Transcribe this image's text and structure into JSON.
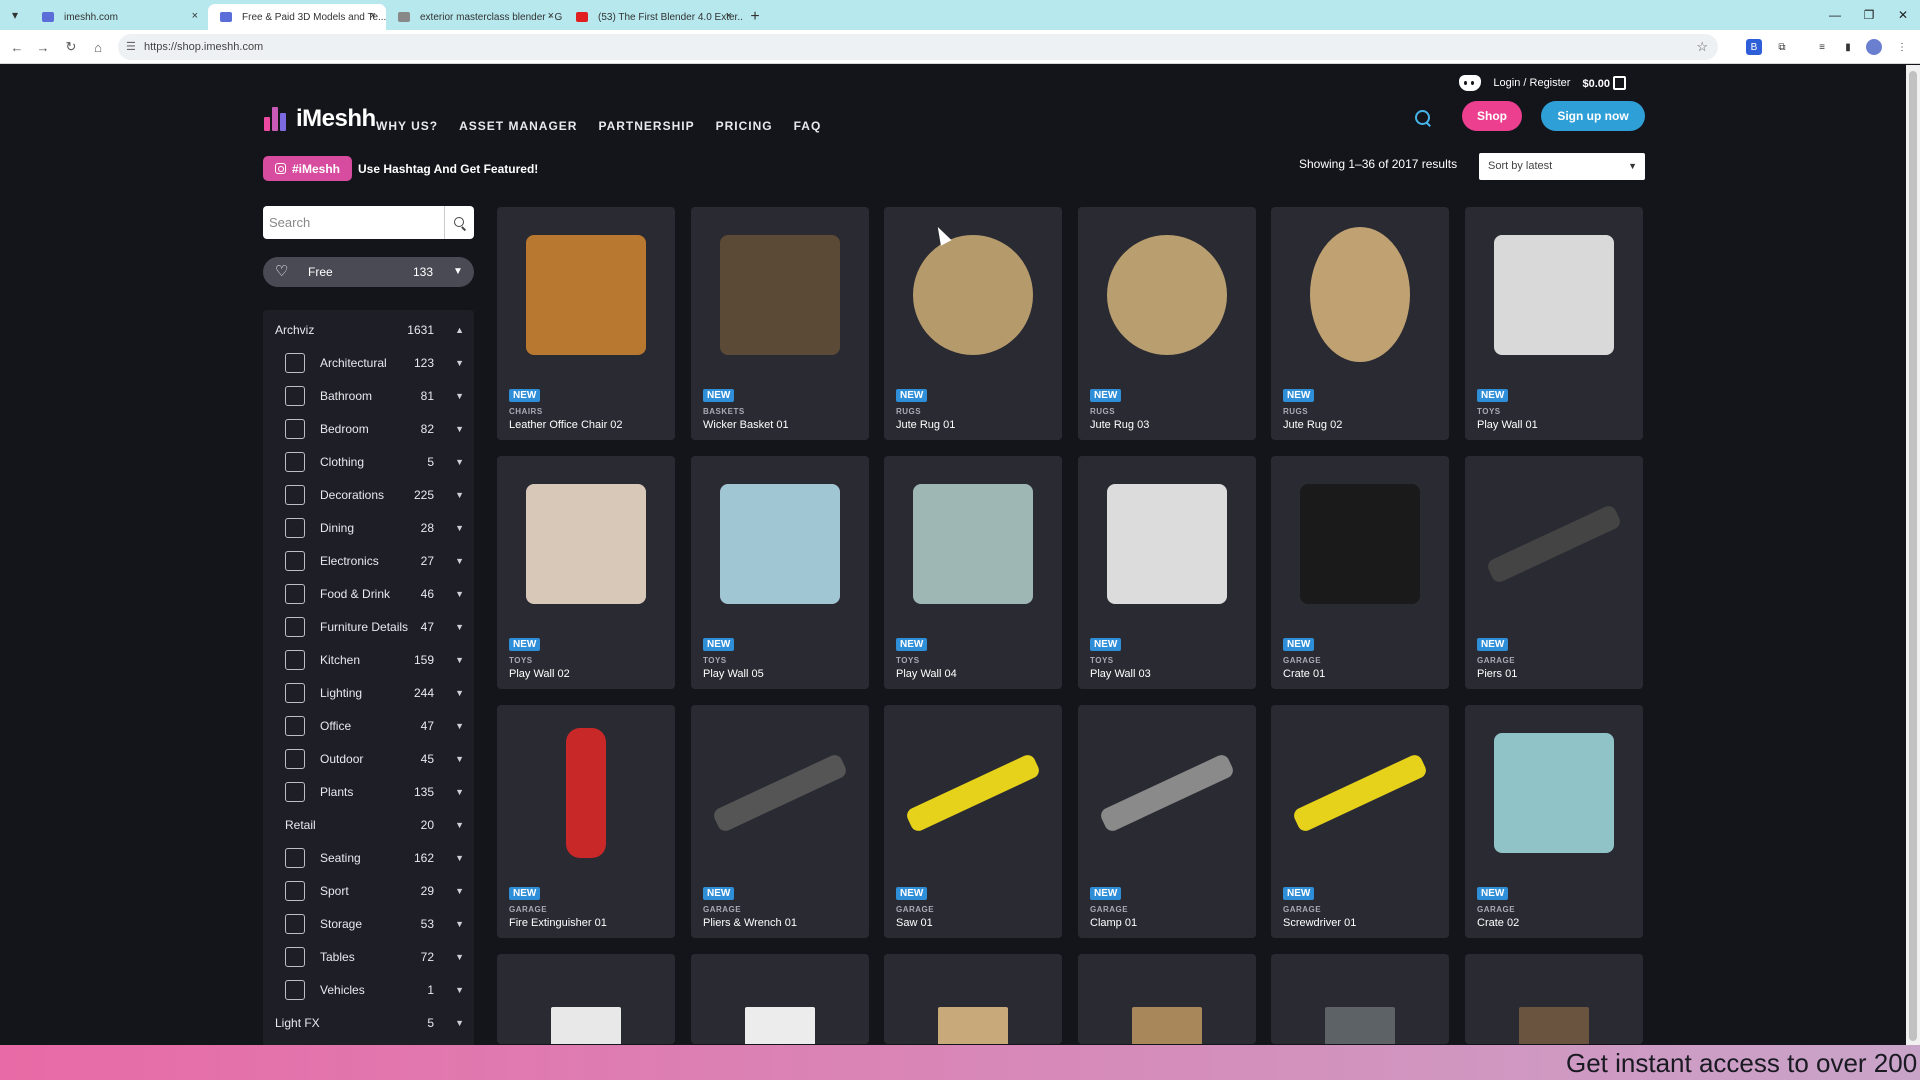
{
  "browser": {
    "tabs": [
      {
        "title": "imeshh.com",
        "active": false,
        "favicon_color": "#5b6dd8"
      },
      {
        "title": "Free & Paid 3D Models and Te...",
        "active": true,
        "favicon_color": "#5b6dd8"
      },
      {
        "title": "exterior masterclass blender - G",
        "active": false,
        "favicon_color": "#888888"
      },
      {
        "title": "(53) The First Blender 4.0 Exter...",
        "active": false,
        "favicon_color": "#e02020"
      }
    ],
    "url": "https://shop.imeshh.com",
    "new_tab_glyph": "+",
    "close_glyph": "×"
  },
  "header": {
    "login": "Login / Register",
    "cart_total": "$0.00",
    "logo_text": "iMeshh",
    "nav": [
      "WHY US?",
      "ASSET MANAGER",
      "PARTNERSHIP",
      "PRICING",
      "FAQ"
    ],
    "shop_button": "Shop",
    "signup_button": "Sign up now"
  },
  "promo": {
    "hashtag": "#iMeshh",
    "text": "Use Hashtag And Get Featured!"
  },
  "results": {
    "text": "Showing 1–36 of 2017 results",
    "sort": "Sort by latest"
  },
  "sidebar": {
    "search_placeholder": "Search",
    "free": {
      "label": "Free",
      "count": "133"
    },
    "section": {
      "label": "Archviz",
      "count": "1631"
    },
    "items": [
      {
        "label": "Architectural",
        "count": "123",
        "icon": "door-icon"
      },
      {
        "label": "Bathroom",
        "count": "81",
        "icon": "toilet-icon"
      },
      {
        "label": "Bedroom",
        "count": "82",
        "icon": "bed-icon"
      },
      {
        "label": "Clothing",
        "count": "5",
        "icon": "shirt-icon"
      },
      {
        "label": "Decorations",
        "count": "225",
        "icon": "vase-icon"
      },
      {
        "label": "Dining",
        "count": "28",
        "icon": "wine-glass-icon"
      },
      {
        "label": "Electronics",
        "count": "27",
        "icon": "monitor-icon"
      },
      {
        "label": "Food & Drink",
        "count": "46",
        "icon": "ice-cream-icon"
      },
      {
        "label": "Furniture Details",
        "count": "47",
        "icon": "cabinet-icon"
      },
      {
        "label": "Kitchen",
        "count": "159",
        "icon": "stove-icon"
      },
      {
        "label": "Lighting",
        "count": "244",
        "icon": "lamp-icon"
      },
      {
        "label": "Office",
        "count": "47",
        "icon": "desk-icon"
      },
      {
        "label": "Outdoor",
        "count": "45",
        "icon": "bbq-icon"
      },
      {
        "label": "Plants",
        "count": "135",
        "icon": "plant-icon"
      },
      {
        "label": "Retail",
        "count": "20",
        "icon": ""
      },
      {
        "label": "Seating",
        "count": "162",
        "icon": "sofa-icon"
      },
      {
        "label": "Sport",
        "count": "29",
        "icon": "dumbbell-icon"
      },
      {
        "label": "Storage",
        "count": "53",
        "icon": "shelf-icon"
      },
      {
        "label": "Tables",
        "count": "72",
        "icon": "table-icon"
      },
      {
        "label": "Vehicles",
        "count": "1",
        "icon": "car-icon"
      }
    ],
    "section2": {
      "label": "Light FX",
      "count": "5"
    }
  },
  "products": [
    {
      "badge": "NEW",
      "category": "CHAIRS",
      "name": "Leather Office Chair 02",
      "color": "#b9782f"
    },
    {
      "badge": "NEW",
      "category": "BASKETS",
      "name": "Wicker Basket 01",
      "color": "#5a4a36"
    },
    {
      "badge": "NEW",
      "category": "RUGS",
      "name": "Jute Rug 01",
      "color": "#b59a6c"
    },
    {
      "badge": "NEW",
      "category": "RUGS",
      "name": "Jute Rug 03",
      "color": "#b99e6f"
    },
    {
      "badge": "NEW",
      "category": "RUGS",
      "name": "Jute Rug 02",
      "color": "#c0a272"
    },
    {
      "badge": "NEW",
      "category": "TOYS",
      "name": "Play Wall 01",
      "color": "#d9d9d9"
    },
    {
      "badge": "NEW",
      "category": "TOYS",
      "name": "Play Wall 02",
      "color": "#d7c8b8"
    },
    {
      "badge": "NEW",
      "category": "TOYS",
      "name": "Play Wall 05",
      "color": "#9fc6d2"
    },
    {
      "badge": "NEW",
      "category": "TOYS",
      "name": "Play Wall 04",
      "color": "#9fb7b4"
    },
    {
      "badge": "NEW",
      "category": "TOYS",
      "name": "Play Wall 03",
      "color": "#dcdcdc"
    },
    {
      "badge": "NEW",
      "category": "GARAGE",
      "name": "Crate 01",
      "color": "#1a1a1a"
    },
    {
      "badge": "NEW",
      "category": "GARAGE",
      "name": "Piers 01",
      "color": "#444444"
    },
    {
      "badge": "NEW",
      "category": "GARAGE",
      "name": "Fire Extinguisher 01",
      "color": "#c82828"
    },
    {
      "badge": "NEW",
      "category": "GARAGE",
      "name": "Pliers & Wrench 01",
      "color": "#555555"
    },
    {
      "badge": "NEW",
      "category": "GARAGE",
      "name": "Saw 01",
      "color": "#e6d21a"
    },
    {
      "badge": "NEW",
      "category": "GARAGE",
      "name": "Clamp 01",
      "color": "#8a8a8a"
    },
    {
      "badge": "NEW",
      "category": "GARAGE",
      "name": "Screwdriver 01",
      "color": "#e6d21a"
    },
    {
      "badge": "NEW",
      "category": "GARAGE",
      "name": "Crate 02",
      "color": "#8fc3c8"
    }
  ],
  "next_row_colors": [
    "#e8e8e8",
    "#ececec",
    "#c7a97a",
    "#a8885a",
    "#5c6266",
    "#6a5440"
  ],
  "banner": {
    "text": "Get instant access to over 200"
  }
}
